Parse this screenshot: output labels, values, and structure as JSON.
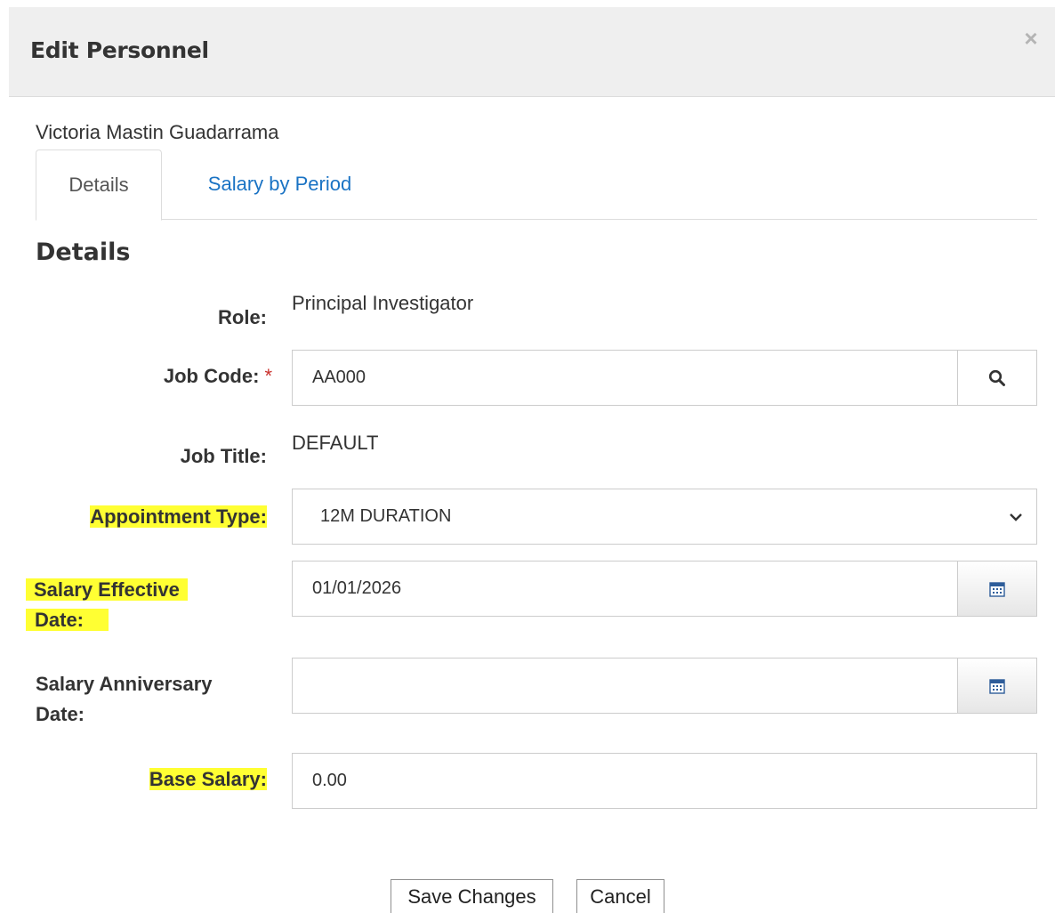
{
  "modal": {
    "title": "Edit Personnel",
    "close_glyph": "×"
  },
  "person": {
    "name": "Victoria Mastin Guadarrama"
  },
  "tabs": [
    {
      "label": "Details",
      "active": true
    },
    {
      "label": "Salary by Period",
      "active": false
    }
  ],
  "section": {
    "heading": "Details"
  },
  "form": {
    "role": {
      "label": "Role:",
      "value": "Principal Investigator"
    },
    "job_code": {
      "label": "Job Code:",
      "required_mark": "*",
      "value": "AA000",
      "icon": "search-icon"
    },
    "job_title": {
      "label": "Job Title:",
      "value": "DEFAULT"
    },
    "appointment_type": {
      "label": "Appointment Type:",
      "value": "12M DURATION",
      "highlighted": true
    },
    "salary_effective_date": {
      "label_line1": "Salary Effective",
      "label_line2": "Date:",
      "value": "01/01/2026",
      "icon": "calendar-icon",
      "highlighted": true
    },
    "salary_anniversary_date": {
      "label_line1": "Salary Anniversary",
      "label_line2": "Date:",
      "value": "",
      "icon": "calendar-icon"
    },
    "base_salary": {
      "label": "Base Salary:",
      "value": "0.00",
      "highlighted": true
    }
  },
  "buttons": {
    "save": "Save Changes",
    "cancel": "Cancel"
  },
  "colors": {
    "highlight": "#ffff33",
    "link": "#1a73c4",
    "required": "#c9302c",
    "header_bg": "#efefef"
  }
}
